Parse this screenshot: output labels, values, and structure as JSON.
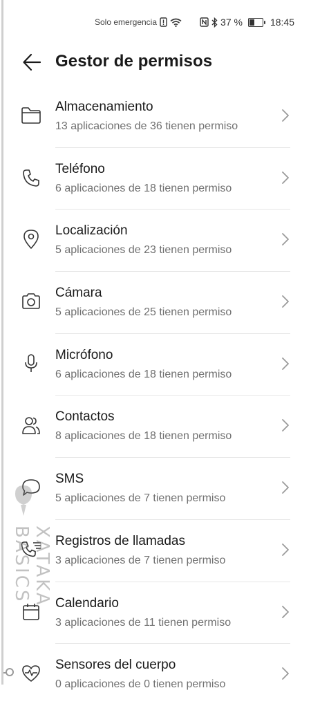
{
  "status_bar": {
    "carrier_text": "Solo emergencia",
    "battery_text": "37 %",
    "battery_level": 0.37,
    "time": "18:45",
    "icons": [
      "sim-alert-icon",
      "wifi-icon",
      "nfc-icon",
      "bluetooth-icon",
      "battery-icon"
    ]
  },
  "header": {
    "back_icon": "back-arrow-icon",
    "title": "Gestor de permisos"
  },
  "permissions": [
    {
      "icon": "folder-icon",
      "label": "Almacenamiento",
      "sub": "13 aplicaciones de 36 tienen permiso"
    },
    {
      "icon": "phone-icon",
      "label": "Teléfono",
      "sub": "6 aplicaciones de 18 tienen permiso"
    },
    {
      "icon": "location-pin-icon",
      "label": "Localización",
      "sub": "5 aplicaciones de 23 tienen permiso"
    },
    {
      "icon": "camera-icon",
      "label": "Cámara",
      "sub": "5 aplicaciones de 25 tienen permiso"
    },
    {
      "icon": "microphone-icon",
      "label": "Micrófono",
      "sub": "6 aplicaciones de 18 tienen permiso"
    },
    {
      "icon": "contacts-icon",
      "label": "Contactos",
      "sub": "8 aplicaciones de 18 tienen permiso"
    },
    {
      "icon": "message-bubble-icon",
      "label": "SMS",
      "sub": "5 aplicaciones de 7 tienen permiso"
    },
    {
      "icon": "call-log-icon",
      "label": "Registros de llamadas",
      "sub": "3 aplicaciones de 7 tienen permiso"
    },
    {
      "icon": "calendar-icon",
      "label": "Calendario",
      "sub": "3 aplicaciones de 11 tienen permiso"
    },
    {
      "icon": "heart-pulse-icon",
      "label": "Sensores del cuerpo",
      "sub": "0 aplicaciones de 0 tienen permiso"
    }
  ],
  "chevron_icon": "chevron-right-icon",
  "watermark": "XATAKA BASICS"
}
